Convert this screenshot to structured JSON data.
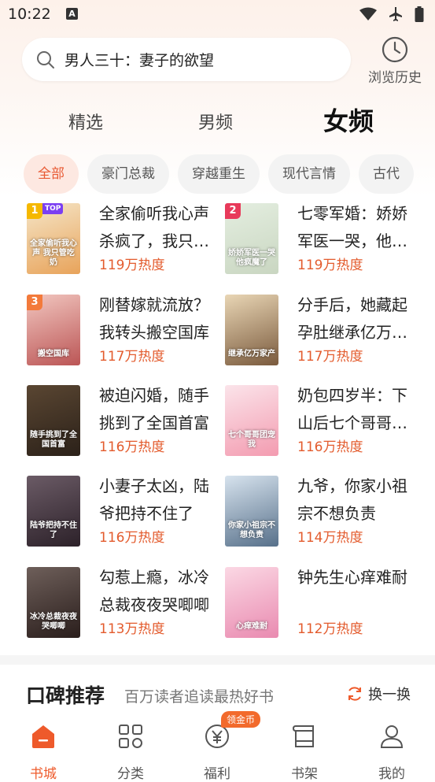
{
  "status": {
    "time": "10:22"
  },
  "search": {
    "query": "男人三十：妻子的欲望"
  },
  "history": {
    "label": "浏览历史"
  },
  "tabs": [
    {
      "label": "精选"
    },
    {
      "label": "男频"
    },
    {
      "label": "女频"
    }
  ],
  "chips": [
    "全部",
    "豪门总裁",
    "穿越重生",
    "现代言情",
    "古代"
  ],
  "books": [
    {
      "rank": "1",
      "rank_extra": "TOP",
      "title": "全家偷听我心声杀疯了，我只管吃奶",
      "heat": "119万热度",
      "cover_text": "全家偷听我心声 我只管吃奶",
      "colors": [
        "#f5e6c8",
        "#e8a35a"
      ]
    },
    {
      "rank": "2",
      "title": "七零军婚：娇娇军医一哭，他疯魔了",
      "heat": "119万热度",
      "cover_text": "娇娇军医一哭 他疯魔了",
      "colors": [
        "#e4eee0",
        "#c9d6c1"
      ]
    },
    {
      "rank": "3",
      "title": "刚替嫁就流放？我转头搬空国库",
      "heat": "117万热度",
      "cover_text": "搬空国库",
      "colors": [
        "#f2c7c0",
        "#b55"
      ]
    },
    {
      "rank": "",
      "title": "分手后，她藏起孕肚继承亿万家产",
      "heat": "117万热度",
      "cover_text": "继承亿万家产",
      "colors": [
        "#e9d6b5",
        "#7a5a3d"
      ]
    },
    {
      "rank": "",
      "title": "被迫闪婚，随手挑到了全国首富",
      "heat": "116万热度",
      "cover_text": "随手挑到了全国首富",
      "colors": [
        "#5a4632",
        "#2b2119"
      ]
    },
    {
      "rank": "",
      "title": "奶包四岁半：下山后七个哥哥团宠我",
      "heat": "116万热度",
      "cover_text": "七个哥哥团宠我",
      "colors": [
        "#fbe4ea",
        "#f39bb0"
      ]
    },
    {
      "rank": "",
      "title": "小妻子太凶，陆爷把持不住了",
      "heat": "116万热度",
      "cover_text": "陆爷把持不住了",
      "colors": [
        "#6b5b66",
        "#2c2129"
      ]
    },
    {
      "rank": "",
      "title": "九爷，你家小祖宗不想负责",
      "heat": "114万热度",
      "cover_text": "你家小祖宗不想负责",
      "colors": [
        "#d7e3ee",
        "#57708a"
      ]
    },
    {
      "rank": "",
      "title": "勾惹上瘾，冰冷总裁夜夜哭唧唧",
      "heat": "113万热度",
      "cover_text": "冰冷总裁夜夜哭唧唧",
      "colors": [
        "#6e5f5a",
        "#2a1e1c"
      ]
    },
    {
      "rank": "",
      "title": "钟先生心痒难耐",
      "heat": "112万热度",
      "cover_text": "心痒难耐",
      "colors": [
        "#fbd8e4",
        "#e98ab0"
      ]
    }
  ],
  "reco": {
    "title": "口碑推荐",
    "subtitle": "百万读者追读最热好书",
    "swap": "换一换"
  },
  "nav": [
    {
      "label": "书城"
    },
    {
      "label": "分类"
    },
    {
      "label": "福利"
    },
    {
      "label": "书架"
    },
    {
      "label": "我的"
    }
  ],
  "badge": "领金币",
  "accent": "#ee5a2b",
  "heat_color": "#e35b2d"
}
